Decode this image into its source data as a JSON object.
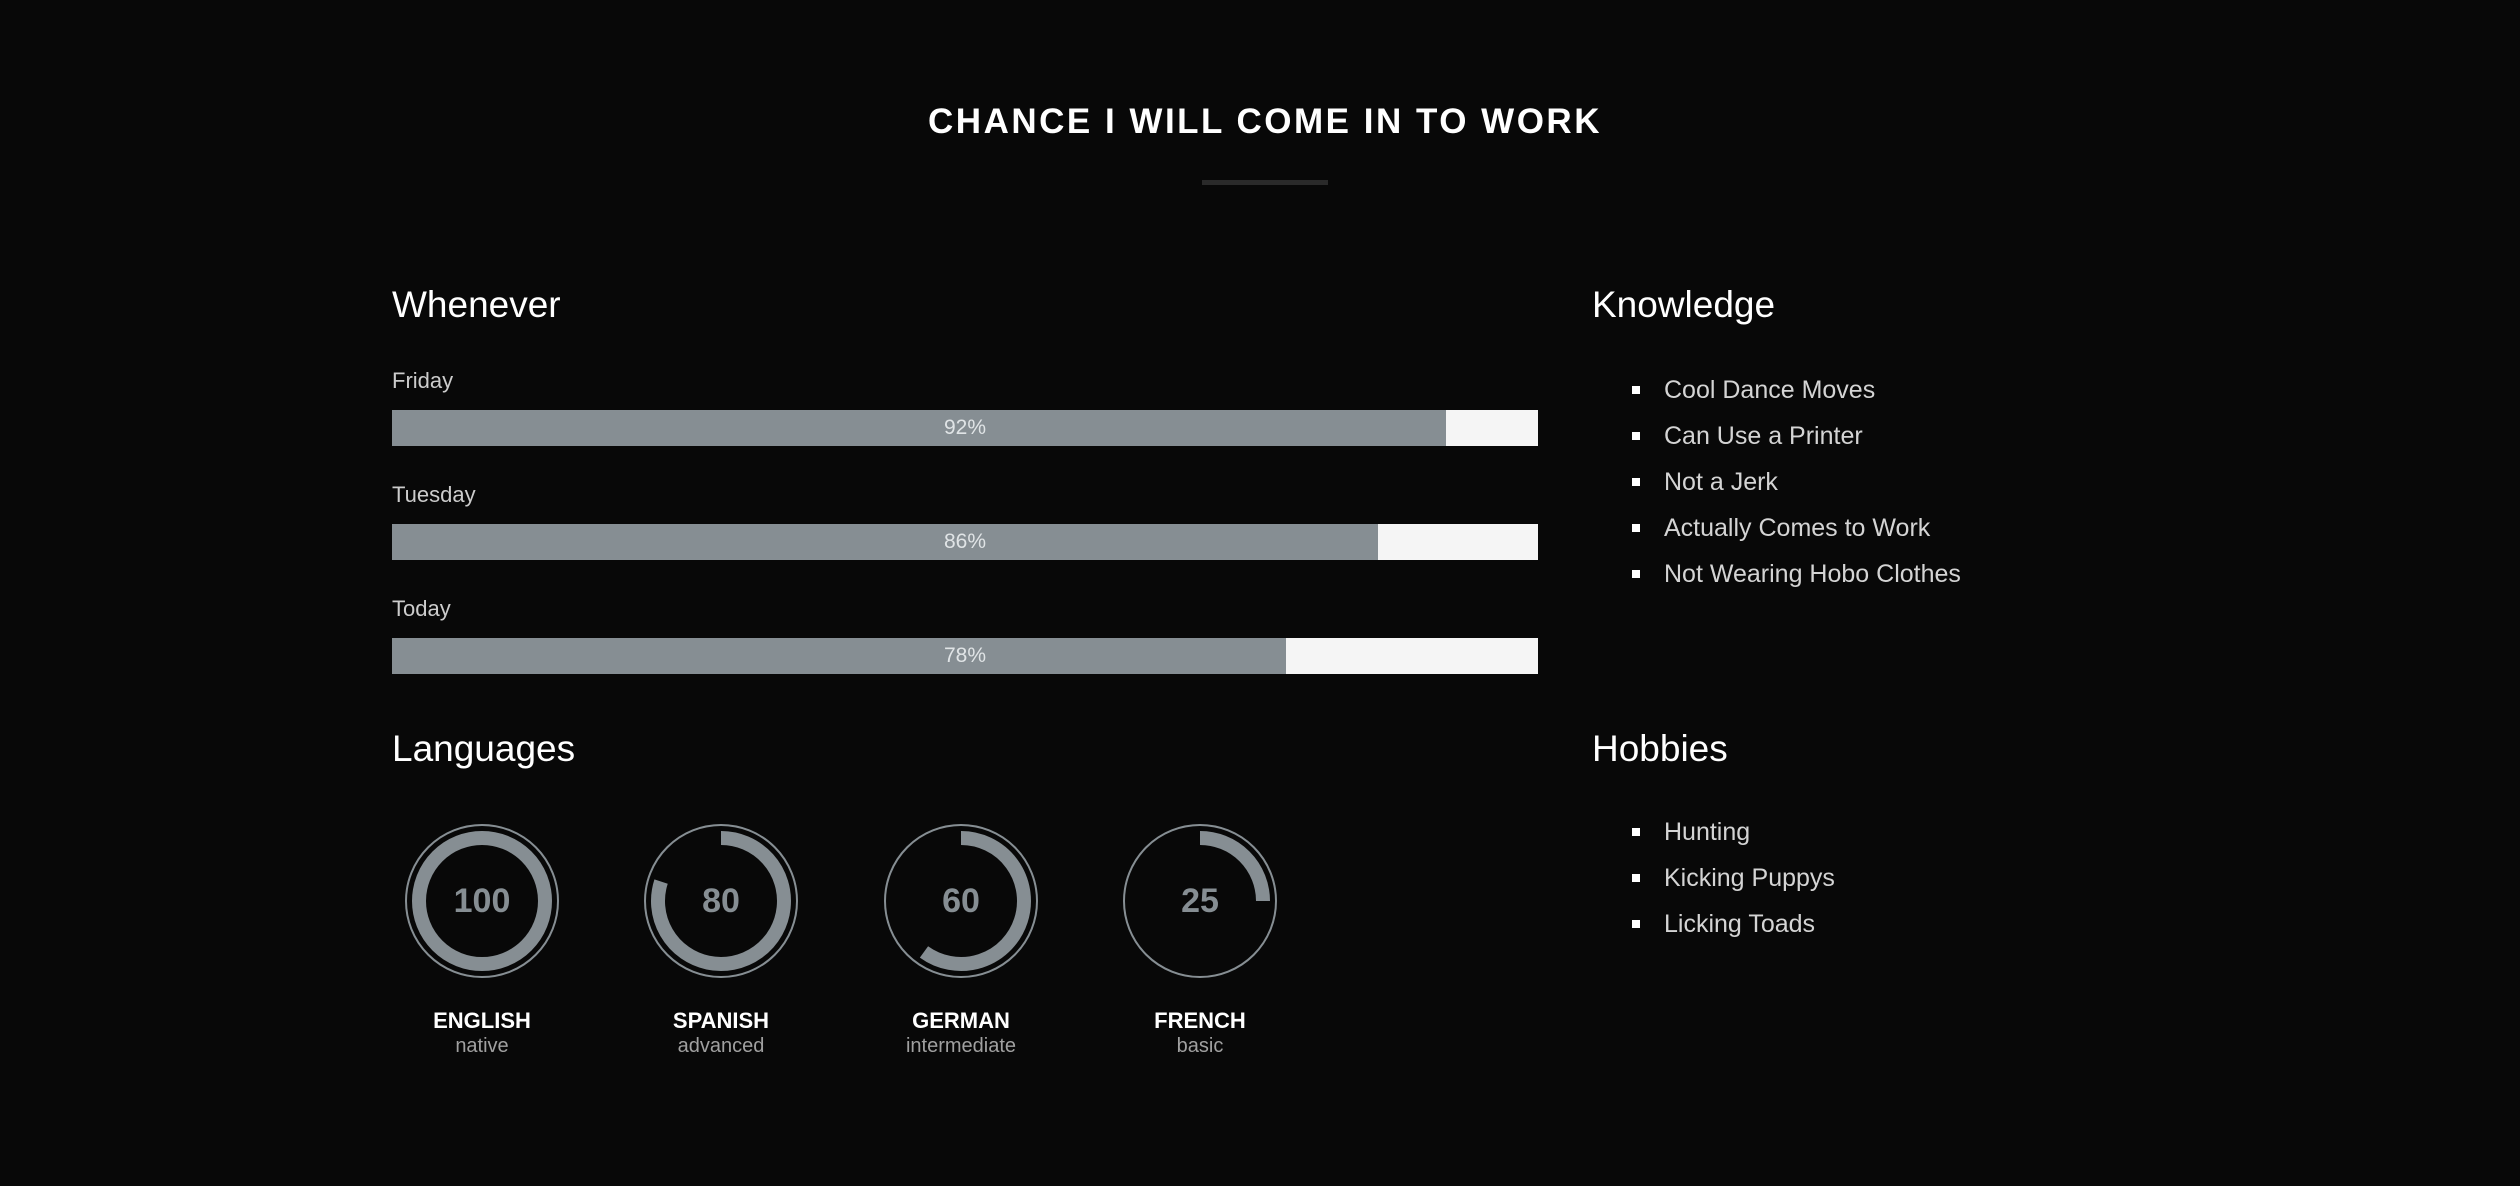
{
  "header": {
    "title": "CHANCE I WILL COME IN TO WORK"
  },
  "whenever": {
    "heading": "Whenever",
    "bars": [
      {
        "label": "Friday",
        "percent": 92,
        "value_text": "92%"
      },
      {
        "label": "Tuesday",
        "percent": 86,
        "value_text": "86%"
      },
      {
        "label": "Today",
        "percent": 78,
        "value_text": "78%"
      }
    ]
  },
  "knowledge": {
    "heading": "Knowledge",
    "items": [
      "Cool Dance Moves",
      "Can Use a Printer",
      "Not a Jerk",
      "Actually Comes to Work",
      "Not Wearing Hobo Clothes"
    ]
  },
  "languages": {
    "heading": "Languages",
    "items": [
      {
        "name": "ENGLISH",
        "level": "native",
        "value": 100,
        "value_text": "100"
      },
      {
        "name": "SPANISH",
        "level": "advanced",
        "value": 80,
        "value_text": "80"
      },
      {
        "name": "GERMAN",
        "level": "intermediate",
        "value": 60,
        "value_text": "60"
      },
      {
        "name": "FRENCH",
        "level": "basic",
        "value": 25,
        "value_text": "25"
      }
    ]
  },
  "hobbies": {
    "heading": "Hobbies",
    "items": [
      "Hunting",
      "Kicking Puppys",
      "Licking Toads"
    ]
  },
  "colors": {
    "background": "#080808",
    "bar_fill": "#868e93",
    "bar_track": "#f5f5f5",
    "ring": "#868e93",
    "text_primary": "#ffffff",
    "text_secondary": "#d4d4d4"
  }
}
